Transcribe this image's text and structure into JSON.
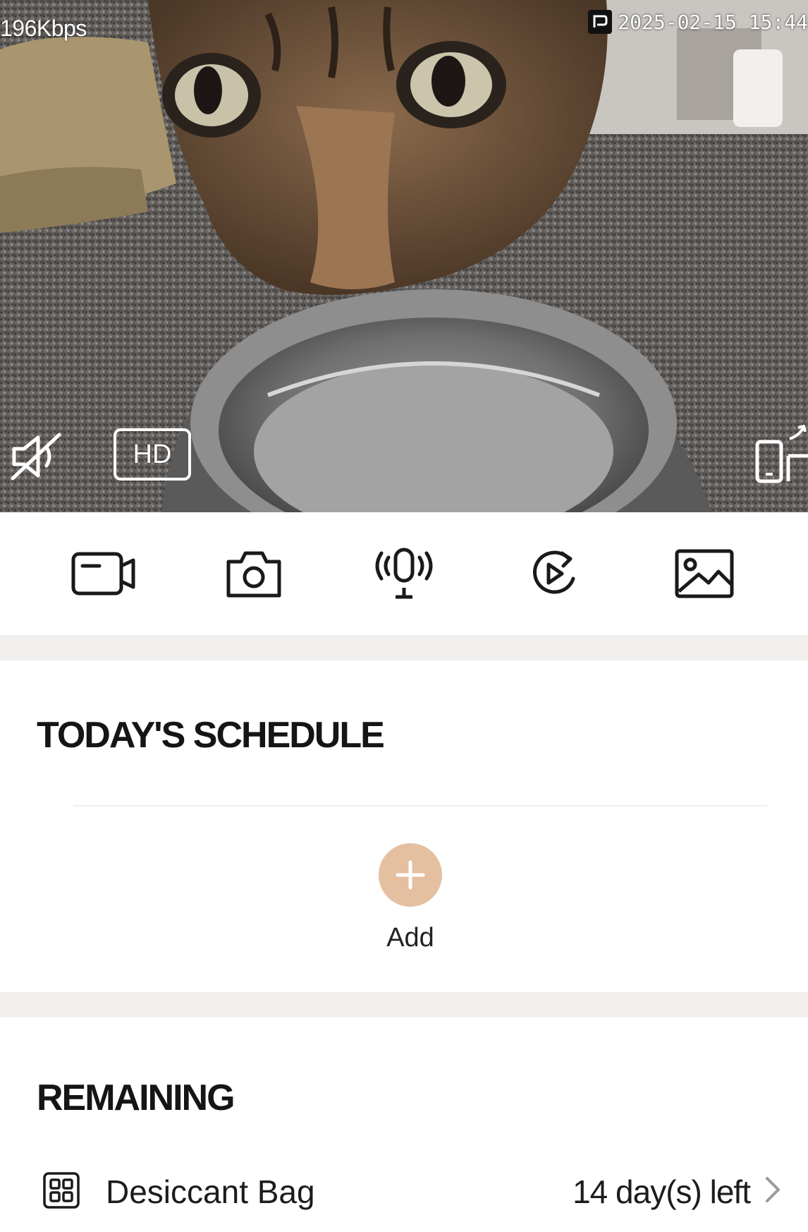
{
  "video": {
    "bitrate": "196Kbps",
    "timestamp": "2025-02-15 15:44",
    "quality_label": "HD"
  },
  "toolbar": {
    "items": [
      {
        "icon": "record-video-icon"
      },
      {
        "icon": "camera-snapshot-icon"
      },
      {
        "icon": "microphone-icon"
      },
      {
        "icon": "playback-icon"
      },
      {
        "icon": "gallery-icon"
      }
    ]
  },
  "schedule": {
    "title": "TODAY'S SCHEDULE",
    "add_label": "Add"
  },
  "remaining": {
    "title": "REMAINING",
    "items": [
      {
        "icon": "desiccant-grid-icon",
        "label": "Desiccant Bag",
        "value": "14 day(s) left"
      }
    ]
  },
  "colors": {
    "accent": "#e4bfa0",
    "separator": "#f0efee",
    "text": "#1a1a1a"
  }
}
